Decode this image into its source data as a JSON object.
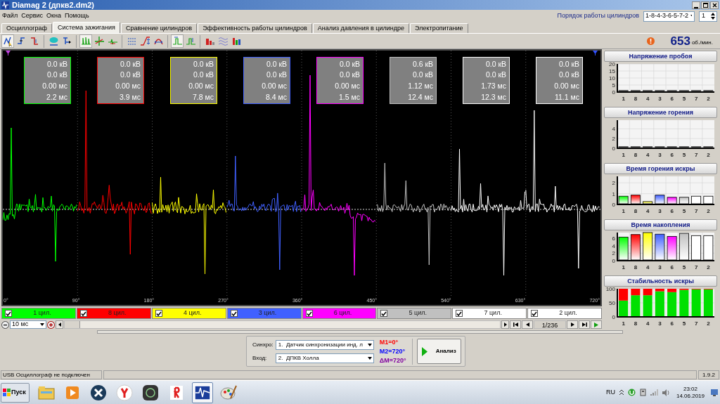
{
  "window": {
    "title": "Diamag 2 (дпкв2.dm2)"
  },
  "menu": [
    "Файл",
    "Сервис",
    "Окна",
    "Помощь"
  ],
  "cylinder_order": {
    "label": "Порядок работы цилиндров",
    "value": "1-8-4-3-6-5-7-2",
    "spinner": "1"
  },
  "tabs": [
    {
      "label": "Осциллограф",
      "selected": false
    },
    {
      "label": "Система зажигания",
      "selected": true
    },
    {
      "label": "Сравнение цилиндров",
      "selected": false
    },
    {
      "label": "Эффективность работы цилиндров",
      "selected": false
    },
    {
      "label": "Анализ давления в цилиндре",
      "selected": false
    },
    {
      "label": "Электропитание",
      "selected": false
    }
  ],
  "rpm": {
    "value": "653",
    "unit": "об./мин."
  },
  "scope": {
    "angle_ticks": [
      "0°",
      "90°",
      "180°",
      "270°",
      "360°",
      "450°",
      "540°",
      "630°",
      "720°"
    ],
    "channels": [
      {
        "label": "1 цил.",
        "color": "#00ff00",
        "checked": true,
        "readings": [
          "0.0 кВ",
          "0.0 кВ",
          "0.00 мс",
          "2.2 мс"
        ]
      },
      {
        "label": "8 цил.",
        "color": "#ff0000",
        "checked": true,
        "readings": [
          "0.0 кВ",
          "0.0 кВ",
          "0.00 мс",
          "3.9 мс"
        ]
      },
      {
        "label": "4 цил.",
        "color": "#ffff00",
        "checked": true,
        "readings": [
          "0.0 кВ",
          "0.0 кВ",
          "0.00 мс",
          "7.8 мс"
        ]
      },
      {
        "label": "3 цил.",
        "color": "#4060ff",
        "checked": true,
        "readings": [
          "0.0 кВ",
          "0.0 кВ",
          "0.00 мс",
          "8.4 мс"
        ]
      },
      {
        "label": "6 цил.",
        "color": "#ff00ff",
        "checked": true,
        "readings": [
          "0.0 кВ",
          "0.0 кВ",
          "0.00 мс",
          "1.5 мс"
        ]
      },
      {
        "label": "5 цил.",
        "color": "#c0c0c0",
        "checked": true,
        "readings": [
          "0.6 кВ",
          "0.0 кВ",
          "1.12 мс",
          "12.4 мс"
        ]
      },
      {
        "label": "7 цил.",
        "color": "#ffffff",
        "checked": true,
        "readings": [
          "0.0 кВ",
          "0.0 кВ",
          "1.73 мс",
          "12.3 мс"
        ]
      },
      {
        "label": "2 цил.",
        "color": "#ffffff",
        "checked": true,
        "readings": [
          "0.0 кВ",
          "0.0 кВ",
          "0.00 мс",
          "11.1 мс"
        ]
      }
    ]
  },
  "timebase": {
    "value": "10 мс"
  },
  "navigation": {
    "position": "1/236"
  },
  "analysis": {
    "sync_label": "Синхро:",
    "sync_value": "1.  Датчик синхронизации инд. л",
    "input_label": "Вход:",
    "input_value": "2.  ДПКВ Холла",
    "markers": [
      {
        "text": "M1=0°",
        "color": "#ff0000"
      },
      {
        "text": "M2=720°",
        "color": "#0000ff"
      },
      {
        "text": "ΔM=720°",
        "color": "#8000a0"
      }
    ],
    "button": "Анализ"
  },
  "charts": [
    {
      "title": "Напряжение пробоя",
      "chart_data": {
        "type": "bar",
        "categories": [
          "1",
          "8",
          "4",
          "3",
          "6",
          "5",
          "7",
          "2"
        ],
        "values": [
          0,
          0,
          0,
          0,
          0,
          0,
          0,
          0
        ],
        "grid": true,
        "ylim": [
          0,
          20
        ],
        "yticks": [
          0,
          5,
          10,
          15,
          20
        ]
      }
    },
    {
      "title": "Напряжение горения",
      "chart_data": {
        "type": "bar",
        "categories": [
          "1",
          "8",
          "4",
          "3",
          "6",
          "5",
          "7",
          "2"
        ],
        "values": [
          0,
          0,
          0,
          0,
          0,
          0,
          0,
          0
        ],
        "grid": true,
        "ylim": [
          0,
          5.8
        ],
        "yticks": [
          0,
          2,
          4
        ]
      }
    },
    {
      "title": "Время горения искры",
      "chart_data": {
        "type": "bar",
        "categories": [
          "1",
          "8",
          "4",
          "3",
          "6",
          "5",
          "7",
          "2"
        ],
        "values": [
          0.7,
          0.8,
          0.2,
          0.8,
          0.6,
          0.6,
          0.7,
          0.7
        ],
        "grid": true,
        "ylim": [
          0,
          2.6
        ],
        "yticks": [
          0,
          1,
          2
        ]
      }
    },
    {
      "title": "Время накопления",
      "chart_data": {
        "type": "bar",
        "categories": [
          "1",
          "8",
          "4",
          "3",
          "6",
          "5",
          "7",
          "2"
        ],
        "values": [
          6.1,
          6.8,
          7.3,
          6.9,
          6.3,
          7.1,
          6.5,
          6.5
        ],
        "grid": true,
        "ylim": [
          0,
          7.5
        ],
        "yticks": [
          0,
          2,
          4,
          6
        ]
      }
    },
    {
      "title": "Стабильность искры",
      "chart_data": {
        "type": "bar",
        "stacked": true,
        "categories": [
          "1",
          "8",
          "4",
          "3",
          "6",
          "5",
          "7",
          "2"
        ],
        "series": [
          {
            "color": "#00e000",
            "values": [
              58,
              77,
              77,
              91,
              88,
              96,
              98,
              98
            ]
          },
          {
            "color": "#ff0000",
            "values": [
              42,
              23,
              23,
              9,
              12,
              4,
              2,
              2
            ]
          }
        ],
        "grid": true,
        "ylim": [
          0,
          100
        ],
        "yticks": [
          0,
          50,
          100
        ]
      }
    }
  ],
  "status_bar": {
    "message": "USB Осциллограф не подключен",
    "version": "1.9.2"
  },
  "taskbar": {
    "start": "Пуск",
    "language": "RU",
    "time": "23:02",
    "date": "14.06.2019"
  }
}
